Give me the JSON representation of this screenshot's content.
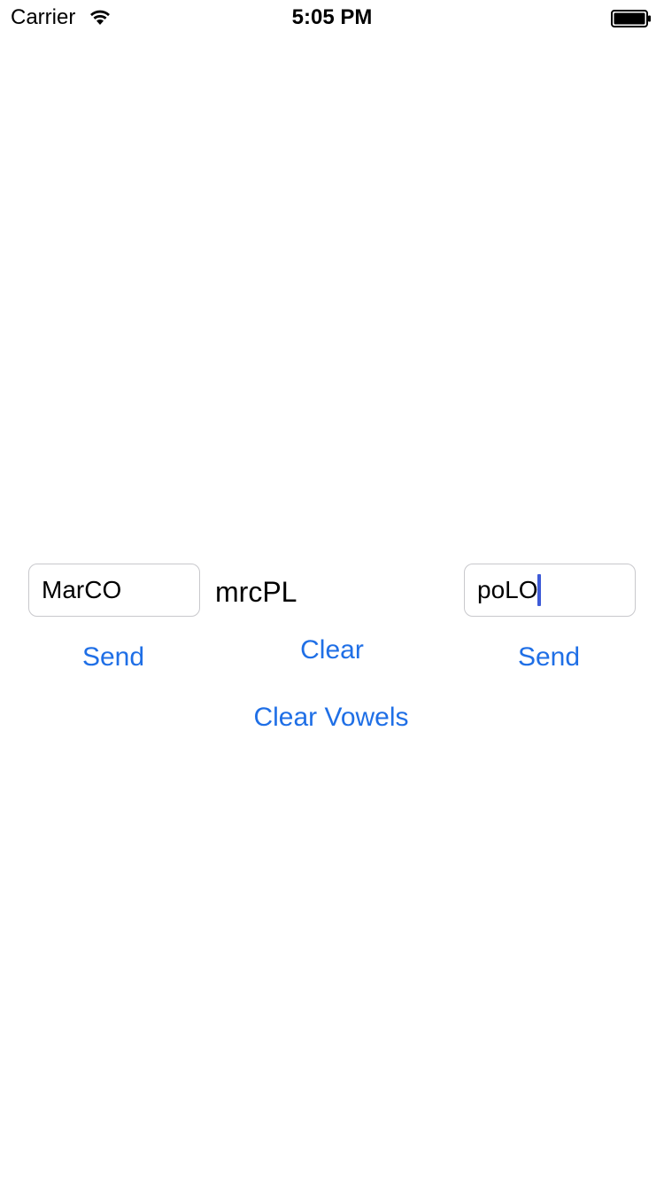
{
  "status_bar": {
    "carrier": "Carrier",
    "time": "5:05 PM",
    "wifi_icon": "wifi-icon",
    "battery_icon": "battery-full-icon"
  },
  "left_field": {
    "value": "MarCO"
  },
  "right_field": {
    "value": "poLO"
  },
  "output_label": "mrcPL",
  "buttons": {
    "send_left": "Send",
    "clear": "Clear",
    "send_right": "Send",
    "clear_vowels": "Clear Vowels"
  },
  "colors": {
    "button_tint": "#1f6fe6",
    "caret": "#3e5bd7",
    "field_border": "#c8c8cc"
  }
}
